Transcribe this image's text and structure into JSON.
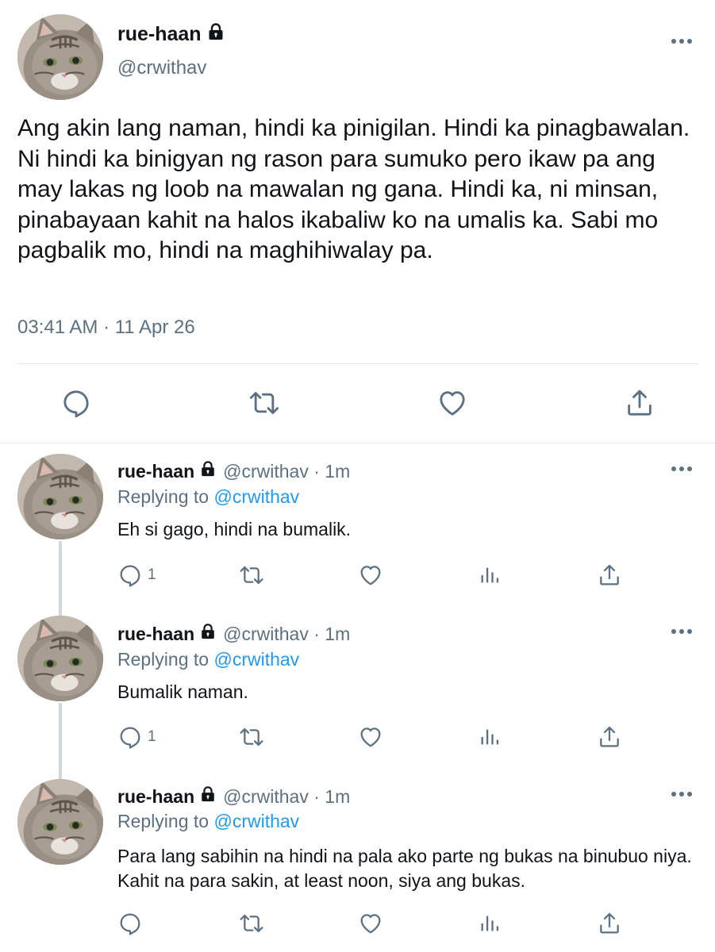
{
  "tweet": {
    "display_name": "rue-haan",
    "handle": "@crwithav",
    "text": "Ang akin lang naman, hindi ka pinigilan. Hindi ka pinagbawalan. Ni hindi ka binigyan ng rason para sumuko pero ikaw pa ang may lakas ng loob na mawalan ng gana. Hindi ka, ni minsan, pinabayaan kahit na halos ikabaliw ko na umalis ka. Sabi mo pagbalik mo, hindi na maghihiwalay pa.",
    "timestamp": "03:41 AM · 11 Apr 26",
    "actions": [
      "reply-icon",
      "retweet-icon",
      "like-icon",
      "share-icon"
    ]
  },
  "replies": [
    {
      "display_name": "rue-haan",
      "handle_time": "@crwithav · 1m",
      "replying_prefix": "Replying to",
      "replying_to": "@crwithav",
      "text": "Eh si gago, hindi na bumalik.",
      "reply_count": "1"
    },
    {
      "display_name": "rue-haan",
      "handle_time": "@crwithav · 1m",
      "replying_prefix": "Replying to",
      "replying_to": "@crwithav",
      "text": "Bumalik naman.",
      "reply_count": "1"
    },
    {
      "display_name": "rue-haan",
      "handle_time": "@crwithav · 1m",
      "replying_prefix": "Replying to",
      "replying_to": "@crwithav",
      "text": "Para lang sabihin na hindi na pala ako parte ng bukas na binubuo niya. Kahit na para sakin, at least noon, siya ang bukas.",
      "reply_count": ""
    }
  ],
  "colors": {
    "text": "#0f1419",
    "muted": "#5b7083",
    "link": "#1d9bf0",
    "divider": "#e1e8ed",
    "thread_line": "#cfd9de"
  }
}
